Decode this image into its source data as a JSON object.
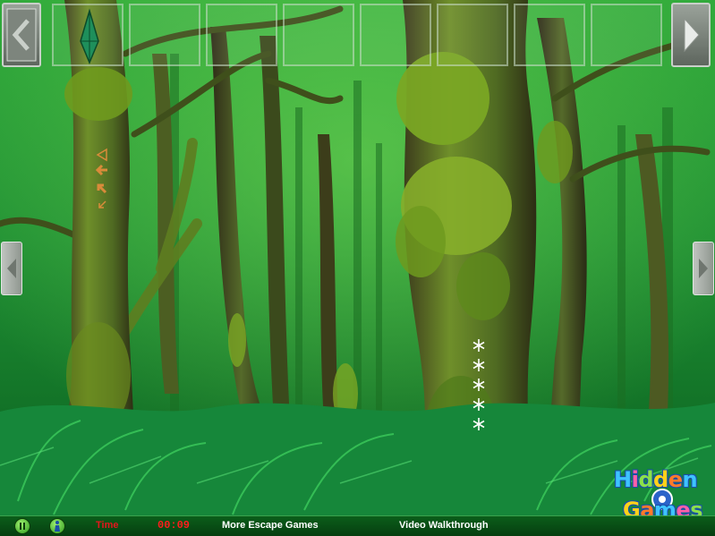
{
  "scene": {
    "name": "mossy forest",
    "colors": {
      "sky": "#39c43a",
      "moss": "#6fa21d",
      "bark": "#4a3a22",
      "fern": "#1f9a3c"
    }
  },
  "inventory": {
    "slot_count": 8,
    "items": [
      {
        "icon": "green-crystal-icon",
        "color": "#1e8f5b"
      }
    ]
  },
  "clues": {
    "arrow_glyphs": [
      "◁",
      "←",
      "↖",
      "↙"
    ],
    "arrow_color": "#d98b3a",
    "snowflake_glyph": "❄",
    "snowflake_count": 5,
    "snowflake_color": "#ffffff"
  },
  "bottom_bar": {
    "time_label": "Time",
    "time_value": "00:09",
    "more_games": "More Escape Games",
    "walkthrough": "Video Walkthrough"
  },
  "logo": {
    "line1": "Hidden",
    "line2": "Games"
  }
}
